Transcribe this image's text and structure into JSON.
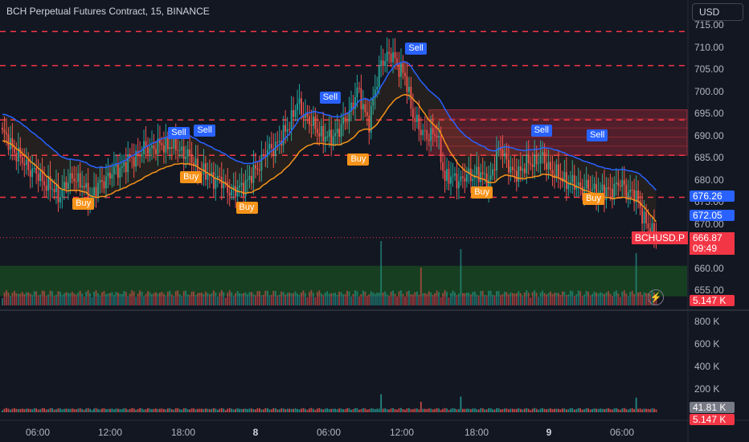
{
  "header": {
    "title": "BCH Perpetual Futures Contract, 15, BINANCE",
    "currency_button": "USD"
  },
  "colors": {
    "background": "#131722",
    "up": "#26a69a",
    "down": "#ef5350",
    "upper_band": "#2962ff",
    "lower_band": "#f7931a",
    "level_line": "#f23645",
    "sell_label": "#2962ff",
    "buy_label": "#f7931a"
  },
  "icons": {
    "replay": "lightning-icon"
  },
  "chart_data": {
    "type": "candlestick",
    "price_axis": {
      "ticks": [
        "715.00",
        "710.00",
        "705.00",
        "700.00",
        "695.00",
        "690.00",
        "685.00",
        "680.00",
        "675.00",
        "670.00",
        "665.00",
        "660.00",
        "655.00"
      ],
      "ylim": [
        653,
        717
      ]
    },
    "volume_axis": {
      "ticks": [
        "800 K",
        "600 K",
        "400 K",
        "200 K"
      ],
      "ylim": [
        0,
        900000
      ]
    },
    "time_axis": {
      "ticks": [
        {
          "label": "06:00",
          "bold": false
        },
        {
          "label": "12:00",
          "bold": false
        },
        {
          "label": "18:00",
          "bold": false
        },
        {
          "label": "8",
          "bold": true
        },
        {
          "label": "06:00",
          "bold": false
        },
        {
          "label": "12:00",
          "bold": false
        },
        {
          "label": "18:00",
          "bold": false
        },
        {
          "label": "9",
          "bold": true
        },
        {
          "label": "06:00",
          "bold": false
        }
      ]
    },
    "horizontal_levels": [
      713.5,
      705.8,
      693.5,
      685.5,
      676.0
    ],
    "supply_zone": [
      685.5,
      695.8
    ],
    "demand_zone": [
      653.6,
      660.5
    ],
    "anchors": [
      {
        "t": 0,
        "p": 690.5
      },
      {
        "t": 10,
        "p": 684
      },
      {
        "t": 20,
        "p": 680
      },
      {
        "t": 28,
        "p": 676.5
      },
      {
        "t": 36,
        "p": 681
      },
      {
        "t": 44,
        "p": 676
      },
      {
        "t": 52,
        "p": 680.5
      },
      {
        "t": 60,
        "p": 683
      },
      {
        "t": 72,
        "p": 687
      },
      {
        "t": 84,
        "p": 688
      },
      {
        "t": 92,
        "p": 686
      },
      {
        "t": 100,
        "p": 681.5
      },
      {
        "t": 108,
        "p": 680
      },
      {
        "t": 116,
        "p": 677
      },
      {
        "t": 124,
        "p": 680
      },
      {
        "t": 132,
        "p": 686
      },
      {
        "t": 140,
        "p": 689
      },
      {
        "t": 148,
        "p": 697
      },
      {
        "t": 156,
        "p": 692
      },
      {
        "t": 164,
        "p": 689
      },
      {
        "t": 172,
        "p": 693
      },
      {
        "t": 178,
        "p": 700
      },
      {
        "t": 184,
        "p": 693
      },
      {
        "t": 190,
        "p": 707
      },
      {
        "t": 196,
        "p": 708
      },
      {
        "t": 202,
        "p": 703
      },
      {
        "t": 206,
        "p": 695
      },
      {
        "t": 210,
        "p": 690.5
      },
      {
        "t": 218,
        "p": 690
      },
      {
        "t": 222,
        "p": 680.5
      },
      {
        "t": 230,
        "p": 680
      },
      {
        "t": 238,
        "p": 681.5
      },
      {
        "t": 244,
        "p": 679.5
      },
      {
        "t": 250,
        "p": 687.5
      },
      {
        "t": 256,
        "p": 681
      },
      {
        "t": 262,
        "p": 683
      },
      {
        "t": 270,
        "p": 685
      },
      {
        "t": 278,
        "p": 681
      },
      {
        "t": 286,
        "p": 679
      },
      {
        "t": 294,
        "p": 678
      },
      {
        "t": 302,
        "p": 677
      },
      {
        "t": 310,
        "p": 679
      },
      {
        "t": 318,
        "p": 676
      },
      {
        "t": 324,
        "p": 669
      },
      {
        "t": 328,
        "p": 666.87
      }
    ],
    "signals": [
      {
        "type": "Buy",
        "t": 40,
        "price": 674.5
      },
      {
        "type": "Sell",
        "t": 88,
        "price": 690.5
      },
      {
        "type": "Buy",
        "t": 94,
        "price": 680.5
      },
      {
        "type": "Sell",
        "t": 101,
        "price": 691
      },
      {
        "type": "Buy",
        "t": 122,
        "price": 673.5
      },
      {
        "type": "Sell",
        "t": 164,
        "price": 698.5
      },
      {
        "type": "Buy",
        "t": 178,
        "price": 684.5
      },
      {
        "type": "Sell",
        "t": 207,
        "price": 709.5
      },
      {
        "type": "Buy",
        "t": 240,
        "price": 677
      },
      {
        "type": "Sell",
        "t": 270,
        "price": 691
      },
      {
        "type": "Buy",
        "t": 296,
        "price": 675.5
      },
      {
        "type": "Sell",
        "t": 298,
        "price": 690
      }
    ],
    "annotations": {
      "upper_band_value": "676.26",
      "lower_band_value": "672.05",
      "symbol": "BCHUSD.P",
      "last_price": "666.87",
      "countdown": "09:49",
      "volume_value": "5.147 K",
      "volume_ma_value": "41.81 K",
      "volume_last_value": "5.147 K"
    }
  }
}
